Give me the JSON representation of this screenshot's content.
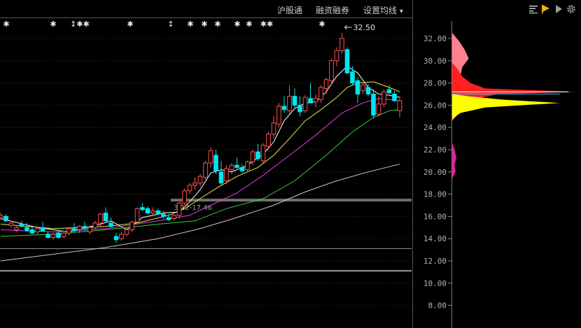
{
  "toolbar": {
    "hgt_label": "沪股通",
    "margin_label": "融资融券",
    "ma_label": "设置均线",
    "dropdown_glyph": "▾"
  },
  "icons": [
    "bars-icon",
    "flag-icon",
    "play-icon",
    "gear-icon"
  ],
  "colors": {
    "up": "#ff5050",
    "down": "#00e5ee",
    "ma5": "#ffffff",
    "ma10": "#e8e84a",
    "ma20": "#e040e0",
    "ma60": "#38d038",
    "ma250": "#c8c8c8",
    "chip_red": "#ff2020",
    "chip_yellow": "#ffff00",
    "chip_pink": "#ff8090",
    "chip_magenta": "#e0209a"
  },
  "event_markers": [
    "✱",
    "✱",
    "↕✱✱",
    "✱",
    "↕",
    "✱",
    "✱",
    "✱",
    "✱",
    "✱",
    "✱✱",
    "✱"
  ],
  "annotations": {
    "high_label": "32.50",
    "level_label": "3-12-17.46"
  },
  "chart_data": {
    "type": "candlestick",
    "title": "",
    "xlabel": "",
    "ylabel": "",
    "ylim": [
      7,
      33.6
    ],
    "yticks": [
      "32.00",
      "30.00",
      "28.00",
      "26.00",
      "24.00",
      "22.00",
      "20.00",
      "18.00",
      "16.00",
      "14.00",
      "12.00",
      "10.00",
      "8.00"
    ],
    "grid": true,
    "high_marker": 32.5,
    "horizontal_levels": [
      17.46,
      13.1,
      11.1
    ],
    "candles": [
      [
        15.9,
        16.3,
        15.7,
        16.1
      ],
      [
        16.0,
        16.2,
        15.5,
        15.6
      ],
      [
        15.2,
        15.6,
        15.0,
        15.4
      ],
      [
        14.8,
        15.2,
        14.6,
        15.0
      ],
      [
        15.3,
        15.6,
        15.0,
        15.1
      ],
      [
        15.0,
        15.4,
        14.6,
        14.7
      ],
      [
        14.8,
        15.0,
        14.4,
        14.5
      ],
      [
        14.6,
        15.0,
        14.4,
        14.9
      ],
      [
        15.0,
        15.5,
        14.6,
        14.7
      ],
      [
        14.4,
        14.6,
        14.0,
        14.1
      ],
      [
        14.1,
        14.5,
        13.9,
        14.4
      ],
      [
        14.5,
        14.8,
        14.0,
        14.1
      ],
      [
        14.2,
        14.6,
        14.0,
        14.5
      ],
      [
        14.5,
        15.0,
        14.3,
        14.9
      ],
      [
        14.9,
        15.4,
        14.6,
        14.7
      ],
      [
        14.8,
        15.2,
        14.5,
        15.1
      ],
      [
        15.1,
        15.5,
        14.7,
        14.9
      ],
      [
        14.6,
        15.2,
        14.4,
        15.0
      ],
      [
        15.0,
        15.6,
        14.8,
        15.4
      ],
      [
        15.4,
        16.3,
        15.1,
        16.2
      ],
      [
        16.3,
        16.8,
        15.5,
        15.6
      ],
      [
        15.4,
        15.9,
        15.0,
        15.1
      ],
      [
        14.2,
        14.5,
        13.6,
        13.9
      ],
      [
        14.0,
        14.6,
        13.8,
        14.4
      ],
      [
        14.4,
        15.0,
        14.2,
        14.8
      ],
      [
        14.8,
        15.6,
        14.6,
        15.5
      ],
      [
        15.5,
        16.8,
        15.3,
        16.7
      ],
      [
        16.8,
        17.2,
        16.5,
        16.6
      ],
      [
        16.7,
        16.9,
        16.2,
        16.3
      ],
      [
        16.3,
        16.8,
        16.0,
        16.5
      ],
      [
        16.5,
        16.7,
        16.1,
        16.2
      ],
      [
        16.2,
        16.5,
        15.8,
        16.0
      ],
      [
        15.9,
        16.2,
        15.6,
        15.7
      ],
      [
        15.8,
        16.2,
        15.6,
        16.1
      ],
      [
        16.1,
        17.3,
        15.8,
        17.2
      ],
      [
        17.2,
        18.5,
        17.0,
        18.3
      ],
      [
        18.3,
        19.0,
        18.0,
        18.8
      ],
      [
        18.8,
        19.5,
        18.4,
        19.0
      ],
      [
        19.0,
        19.8,
        18.7,
        19.6
      ],
      [
        19.5,
        21.0,
        19.3,
        20.8
      ],
      [
        20.8,
        22.2,
        20.4,
        21.9
      ],
      [
        21.5,
        22.0,
        19.8,
        20.1
      ],
      [
        20.0,
        21.0,
        18.8,
        19.0
      ],
      [
        19.2,
        20.6,
        18.9,
        20.3
      ],
      [
        20.2,
        20.8,
        19.8,
        20.6
      ],
      [
        20.6,
        21.3,
        20.3,
        20.4
      ],
      [
        20.4,
        20.7,
        19.9,
        20.1
      ],
      [
        20.2,
        21.0,
        20.0,
        20.9
      ],
      [
        20.9,
        22.0,
        20.6,
        21.8
      ],
      [
        21.8,
        22.5,
        21.0,
        21.2
      ],
      [
        21.0,
        22.6,
        20.8,
        22.4
      ],
      [
        22.3,
        23.6,
        22.0,
        23.4
      ],
      [
        23.4,
        25.0,
        23.0,
        24.4
      ],
      [
        24.3,
        26.2,
        24.0,
        25.9
      ],
      [
        25.9,
        26.8,
        25.3,
        25.6
      ],
      [
        25.5,
        27.8,
        25.2,
        26.8
      ],
      [
        26.8,
        27.5,
        25.8,
        26.0
      ],
      [
        26.0,
        26.8,
        25.0,
        25.4
      ],
      [
        25.5,
        26.9,
        25.3,
        26.7
      ],
      [
        26.6,
        28.0,
        26.2,
        26.2
      ],
      [
        26.3,
        27.0,
        25.8,
        26.6
      ],
      [
        26.5,
        27.8,
        26.2,
        27.6
      ],
      [
        27.5,
        28.5,
        27.0,
        28.3
      ],
      [
        28.2,
        30.2,
        27.8,
        30.0
      ],
      [
        30.0,
        31.2,
        29.5,
        30.9
      ],
      [
        30.9,
        32.5,
        30.6,
        32.0
      ],
      [
        31.0,
        31.2,
        28.8,
        28.9
      ],
      [
        29.0,
        29.5,
        27.8,
        28.0
      ],
      [
        28.2,
        28.5,
        26.2,
        27.0
      ],
      [
        27.3,
        28.0,
        27.0,
        27.8
      ],
      [
        27.6,
        27.9,
        26.8,
        27.0
      ],
      [
        27.0,
        27.4,
        24.8,
        25.1
      ],
      [
        25.2,
        26.8,
        25.0,
        26.1
      ],
      [
        26.1,
        27.4,
        25.8,
        27.2
      ],
      [
        27.4,
        27.8,
        27.0,
        27.1
      ],
      [
        27.0,
        27.3,
        26.3,
        26.4
      ],
      [
        25.5,
        26.8,
        24.9,
        26.4
      ]
    ],
    "ma_series": [
      {
        "name": "",
        "color_key": "ma5",
        "values": [
          [
            0,
            15.8
          ],
          [
            7,
            15.0
          ],
          [
            13,
            14.6
          ],
          [
            19,
            15.3
          ],
          [
            21,
            15.6
          ],
          [
            24,
            14.8
          ],
          [
            27,
            15.9
          ],
          [
            31,
            16.3
          ],
          [
            34,
            16.4
          ],
          [
            36,
            17.3
          ],
          [
            38,
            18.4
          ],
          [
            40,
            19.9
          ],
          [
            42,
            20.2
          ],
          [
            44,
            20.0
          ],
          [
            47,
            20.6
          ],
          [
            50,
            21.6
          ],
          [
            52,
            22.7
          ],
          [
            54,
            24.6
          ],
          [
            56,
            25.7
          ],
          [
            58,
            26.2
          ],
          [
            60,
            26.3
          ],
          [
            62,
            27.2
          ],
          [
            64,
            28.6
          ],
          [
            66,
            29.5
          ],
          [
            68,
            28.9
          ],
          [
            70,
            27.6
          ],
          [
            72,
            27.0
          ],
          [
            74,
            26.9
          ],
          [
            76,
            26.7
          ]
        ]
      },
      {
        "name": "",
        "color_key": "ma10",
        "values": [
          [
            0,
            15.3
          ],
          [
            10,
            14.9
          ],
          [
            20,
            15.1
          ],
          [
            26,
            15.4
          ],
          [
            32,
            16.1
          ],
          [
            35,
            16.7
          ],
          [
            38,
            17.6
          ],
          [
            41,
            18.5
          ],
          [
            45,
            19.6
          ],
          [
            49,
            20.4
          ],
          [
            52,
            21.5
          ],
          [
            55,
            23.0
          ],
          [
            58,
            24.6
          ],
          [
            61,
            25.6
          ],
          [
            64,
            26.7
          ],
          [
            66,
            27.6
          ],
          [
            68,
            28.0
          ],
          [
            71,
            28.1
          ],
          [
            74,
            27.6
          ],
          [
            76,
            27.2
          ]
        ]
      },
      {
        "name": "",
        "color_key": "ma20",
        "values": [
          [
            0,
            14.8
          ],
          [
            10,
            14.6
          ],
          [
            20,
            14.9
          ],
          [
            30,
            15.6
          ],
          [
            36,
            16.1
          ],
          [
            40,
            17.0
          ],
          [
            45,
            18.1
          ],
          [
            50,
            19.7
          ],
          [
            55,
            21.5
          ],
          [
            60,
            23.3
          ],
          [
            65,
            25.3
          ],
          [
            69,
            26.2
          ],
          [
            72,
            26.6
          ],
          [
            76,
            26.4
          ]
        ]
      },
      {
        "name": "",
        "color_key": "ma60",
        "values": [
          [
            0,
            14.2
          ],
          [
            10,
            14.4
          ],
          [
            20,
            14.8
          ],
          [
            30,
            15.3
          ],
          [
            37,
            15.6
          ],
          [
            43,
            16.7
          ],
          [
            50,
            17.6
          ],
          [
            56,
            19.2
          ],
          [
            62,
            21.5
          ],
          [
            67,
            23.6
          ],
          [
            71,
            24.9
          ],
          [
            74,
            25.5
          ],
          [
            76,
            25.6
          ]
        ]
      },
      {
        "name": "",
        "color_key": "ma250",
        "values": [
          [
            0,
            12.0
          ],
          [
            10,
            12.6
          ],
          [
            20,
            13.2
          ],
          [
            30,
            14.0
          ],
          [
            38,
            14.9
          ],
          [
            45,
            15.9
          ],
          [
            52,
            17.0
          ],
          [
            58,
            18.2
          ],
          [
            64,
            19.2
          ],
          [
            70,
            20.0
          ],
          [
            76,
            20.7
          ]
        ]
      }
    ],
    "chip_distribution": [
      {
        "color_key": "chip_magenta",
        "points": [
          [
            19.4,
            0
          ],
          [
            20.0,
            4
          ],
          [
            20.6,
            3
          ],
          [
            21.3,
            5
          ],
          [
            22.0,
            3
          ],
          [
            22.6,
            0
          ]
        ]
      },
      {
        "color_key": "chip_pink",
        "points": [
          [
            24.6,
            0
          ],
          [
            25.2,
            7
          ],
          [
            26.0,
            12
          ],
          [
            26.6,
            14
          ],
          [
            27.4,
            20
          ],
          [
            28.0,
            16
          ],
          [
            28.6,
            10
          ],
          [
            29.4,
            12
          ],
          [
            30.2,
            20
          ],
          [
            31.0,
            15
          ],
          [
            31.8,
            8
          ],
          [
            32.5,
            0
          ]
        ]
      },
      {
        "color_key": "chip_red",
        "points": [
          [
            25.2,
            0
          ],
          [
            26.0,
            18
          ],
          [
            26.6,
            30
          ],
          [
            27.0,
            55
          ],
          [
            27.2,
            150
          ],
          [
            27.5,
            40
          ],
          [
            28.0,
            22
          ],
          [
            28.6,
            12
          ],
          [
            29.3,
            6
          ],
          [
            29.8,
            0
          ]
        ]
      },
      {
        "color_key": "chip_yellow",
        "points": [
          [
            24.8,
            0
          ],
          [
            25.3,
            10
          ],
          [
            25.8,
            40
          ],
          [
            26.2,
            130
          ],
          [
            26.5,
            60
          ],
          [
            26.8,
            20
          ],
          [
            27.0,
            0
          ]
        ]
      }
    ]
  }
}
